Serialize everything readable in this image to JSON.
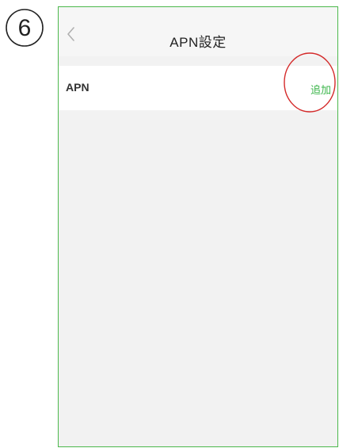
{
  "step_badge": {
    "label": "⑥"
  },
  "navbar": {
    "title": "APN設定",
    "back_icon": "chevron-left-icon"
  },
  "apn_row": {
    "label": "APN",
    "add_label": "追加"
  },
  "colors": {
    "frame_border": "#4cb84c",
    "accent_green": "#3bb54a",
    "highlight_red": "#d42a2a",
    "screen_background": "#f2f2f2"
  }
}
